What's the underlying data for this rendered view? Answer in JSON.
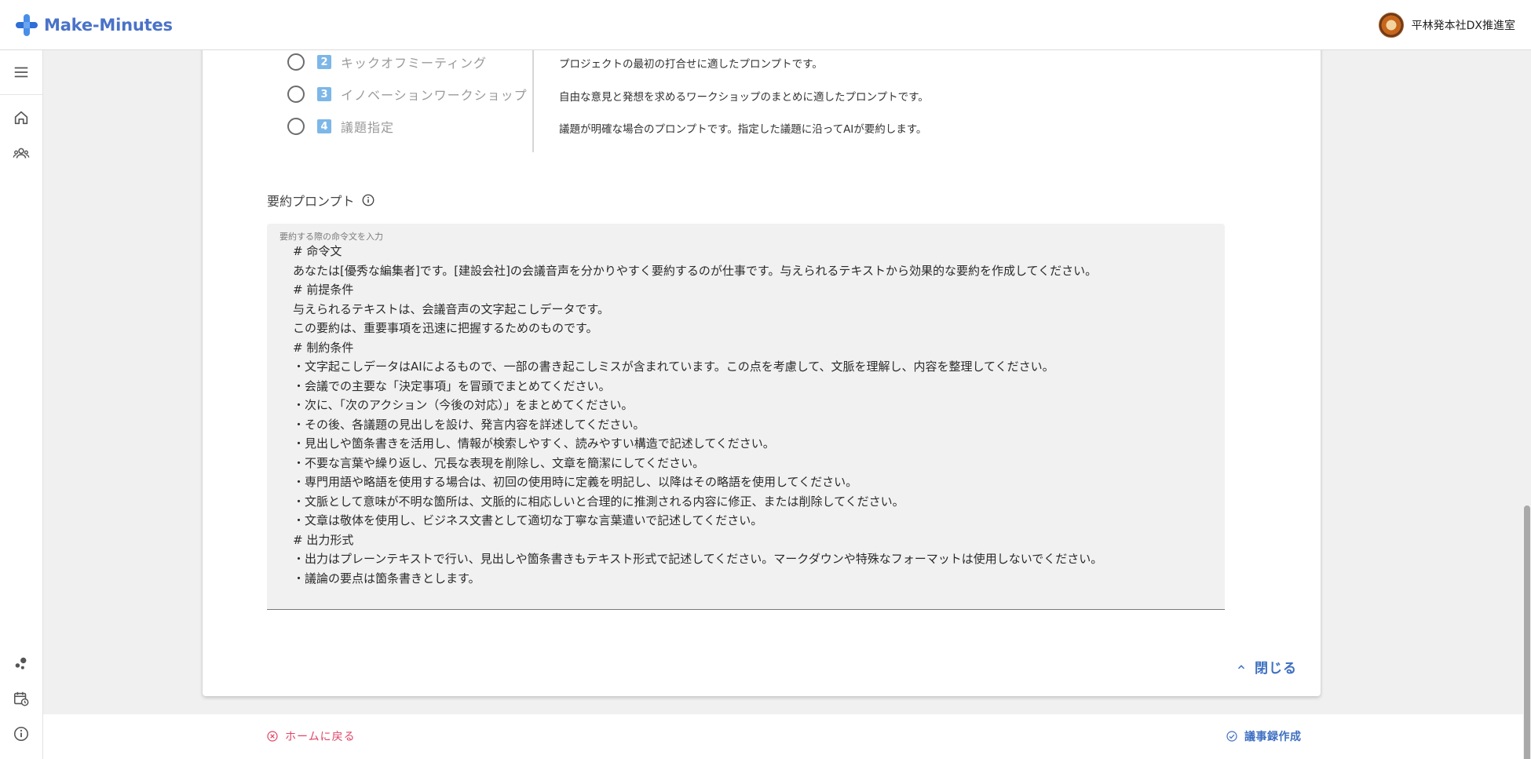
{
  "app": {
    "title": "Make-Minutes",
    "user_name": "平林発本社DX推進室",
    "accent_color": "#4a72c8"
  },
  "sidebar": {
    "items": [
      {
        "icon": "menu-icon"
      },
      {
        "icon": "home-icon"
      },
      {
        "icon": "users-icon"
      },
      {
        "icon": "bubbles-icon"
      },
      {
        "icon": "calendar-clock-icon"
      },
      {
        "icon": "info-icon"
      }
    ]
  },
  "templates": {
    "options": [
      {
        "number": "2",
        "label": "キックオフミーティング",
        "description": "プロジェクトの最初の打合せに適したプロンプトです。"
      },
      {
        "number": "3",
        "label": "イノベーションワークショップ",
        "description": "自由な意見と発想を求めるワークショップのまとめに適したプロンプトです。"
      },
      {
        "number": "4",
        "label": "議題指定",
        "description": "議題が明確な場合のプロンプトです。指定した議題に沿ってAIが要約します。"
      }
    ]
  },
  "prompt": {
    "title": "要約プロンプト",
    "placeholder": "要約する際の命令文を入力",
    "lines": [
      "# 命令文",
      "あなたは[優秀な編集者]です。[建設会社]の会議音声を分かりやすく要約するのが仕事です。与えられるテキストから効果的な要約を作成してください。",
      "# 前提条件",
      "与えられるテキストは、会議音声の文字起こしデータです。",
      "この要約は、重要事項を迅速に把握するためのものです。",
      "# 制約条件",
      "・文字起こしデータはAIによるもので、一部の書き起こしミスが含まれています。この点を考慮して、文脈を理解し、内容を整理してください。",
      "・会議での主要な「決定事項」を冒頭でまとめてください。",
      "・次に、「次のアクション（今後の対応）」をまとめてください。",
      "・その後、各議題の見出しを設け、発言内容を詳述してください。",
      "・見出しや箇条書きを活用し、情報が検索しやすく、読みやすい構造で記述してください。",
      "・不要な言葉や繰り返し、冗長な表現を削除し、文章を簡潔にしてください。",
      "・専門用語や略語を使用する場合は、初回の使用時に定義を明記し、以降はその略語を使用してください。",
      "・文脈として意味が不明な箇所は、文脈的に相応しいと合理的に推測される内容に修正、または削除してください。",
      "・文章は敬体を使用し、ビジネス文書として適切な丁寧な言葉遣いで記述してください。",
      "# 出力形式",
      "・出力はプレーンテキストで行い、見出しや箇条書きもテキスト形式で記述してください。マークダウンや特殊なフォーマットは使用しないでください。",
      "・議論の要点は箇条書きとします。"
    ]
  },
  "actions": {
    "close_label": "閉じる",
    "home_label": "ホームに戻る",
    "create_label": "議事録作成"
  },
  "colors": {
    "danger": "#e04466",
    "primary": "#3e6fc2",
    "badge": "#7cb7e8"
  }
}
